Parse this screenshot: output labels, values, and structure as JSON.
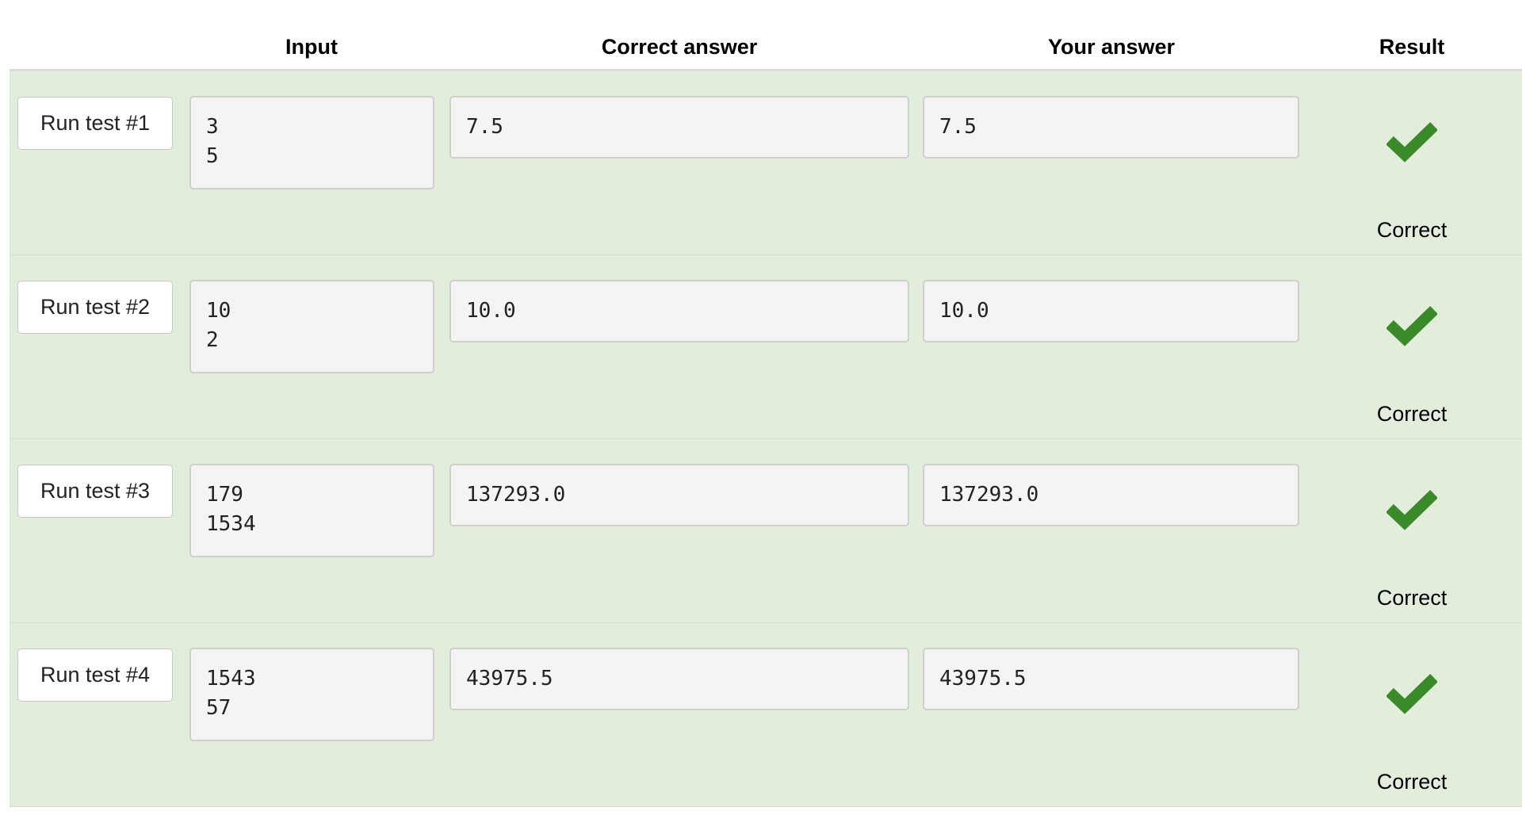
{
  "headers": {
    "input": "Input",
    "expected": "Correct answer",
    "got": "Your answer",
    "result": "Result"
  },
  "tests": [
    {
      "button": "Run test #1",
      "input": "3\n5",
      "expected": "7.5",
      "got": "7.5",
      "result": "Correct",
      "icon": "checkmark-icon"
    },
    {
      "button": "Run test #2",
      "input": "10\n2",
      "expected": "10.0",
      "got": "10.0",
      "result": "Correct",
      "icon": "checkmark-icon"
    },
    {
      "button": "Run test #3",
      "input": "179\n1534",
      "expected": "137293.0",
      "got": "137293.0",
      "result": "Correct",
      "icon": "checkmark-icon"
    },
    {
      "button": "Run test #4",
      "input": "1543\n57",
      "expected": "43975.5",
      "got": "43975.5",
      "result": "Correct",
      "icon": "checkmark-icon"
    }
  ],
  "colors": {
    "row_pass_bg": "#e2eedb",
    "check_green": "#3a8a2a"
  }
}
